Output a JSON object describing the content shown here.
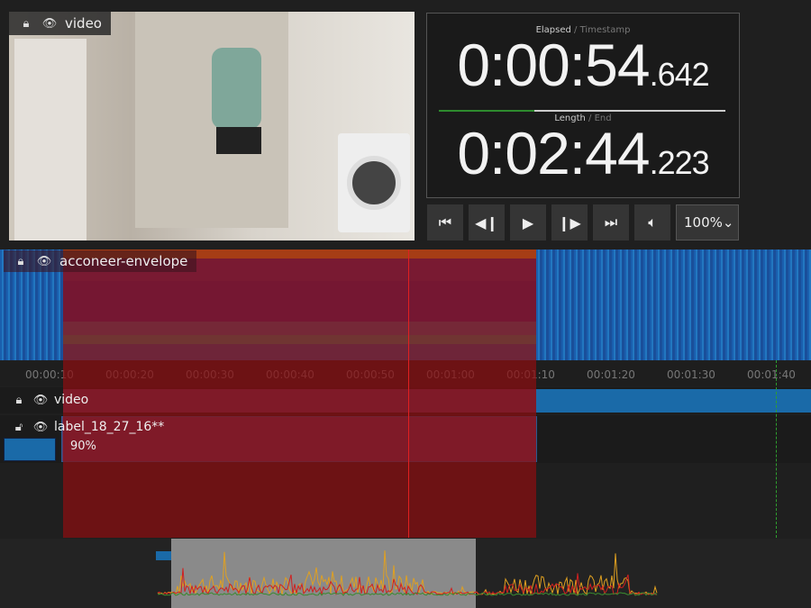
{
  "video_panel": {
    "label": "video"
  },
  "timer": {
    "elapsed_label": "Elapsed",
    "timestamp_label": "Timestamp",
    "elapsed_main": "0:00:54",
    "elapsed_ms": ".642",
    "length_label": "Length",
    "end_label": "End",
    "length_main": "0:02:44",
    "length_ms": ".223",
    "progress": 0.333
  },
  "controls": {
    "zoom_value": "100%",
    "buttons": [
      "skip-to-start",
      "step-back",
      "play",
      "step-forward",
      "skip-to-end",
      "volume"
    ]
  },
  "tracks": {
    "spectrogram_label": "acconeer-envelope",
    "video_label": "video",
    "label_track": "label_18_27_16**",
    "label_confidence": "90%"
  },
  "ruler": {
    "ticks": [
      "00:00:10",
      "00:00:20",
      "00:00:30",
      "00:00:40",
      "00:00:50",
      "00:01:00",
      "00:01:10",
      "00:01:20",
      "00:01:30",
      "00:01:40"
    ]
  },
  "colors": {
    "selection": "#8c0e10",
    "playhead": "#e02020",
    "accent_blue": "#1a6aa8",
    "progress": "#2e8b2e"
  }
}
